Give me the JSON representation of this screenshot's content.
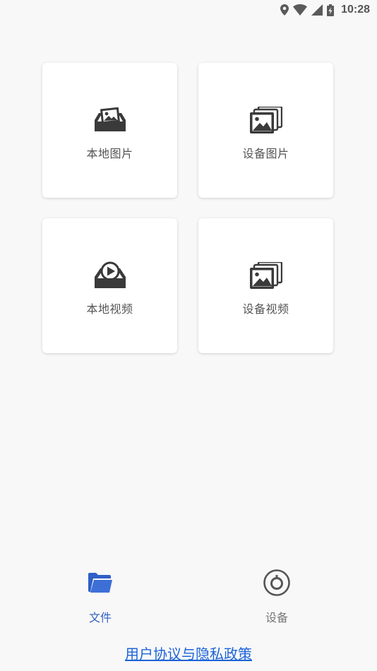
{
  "status_bar": {
    "time": "10:28",
    "icons": [
      "location-icon",
      "wifi-icon",
      "signal-icon",
      "battery-charging-icon"
    ]
  },
  "cards": [
    {
      "label": "本地图片",
      "icon": "local-image-icon"
    },
    {
      "label": "设备图片",
      "icon": "device-image-icon"
    },
    {
      "label": "本地视频",
      "icon": "local-video-icon"
    },
    {
      "label": "设备视频",
      "icon": "device-video-icon"
    }
  ],
  "bottom_nav": {
    "items": [
      {
        "label": "文件",
        "icon": "folder-icon",
        "active": true
      },
      {
        "label": "设备",
        "icon": "device-target-icon",
        "active": false
      }
    ]
  },
  "policy_link": "用户协议与隐私政策",
  "colors": {
    "background": "#f8f8f8",
    "card": "#ffffff",
    "icon_dark": "#3a3a3a",
    "nav_active": "#2f5fc7",
    "nav_inactive": "#777777",
    "link": "#1d64d8"
  }
}
